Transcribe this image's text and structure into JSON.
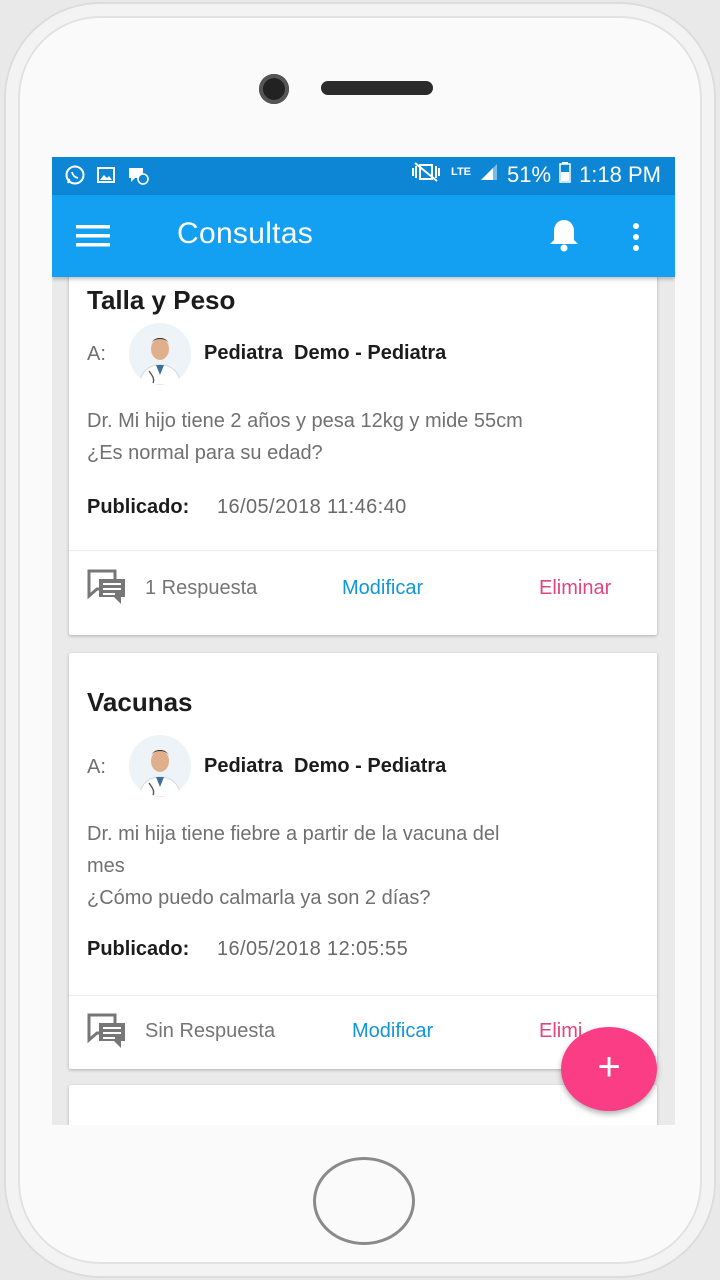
{
  "statusbar": {
    "battery": "51%",
    "time": "1:18 PM",
    "network": "LTE",
    "left_icons": [
      "whatsapp-icon",
      "image-icon",
      "message-icon"
    ],
    "right_icons": [
      "mute-vibrate-icon",
      "lte-icon",
      "signal-icon",
      "battery-icon"
    ]
  },
  "appbar": {
    "title": "Consultas",
    "icons": [
      "menu-icon",
      "bell-icon",
      "more-vert-icon"
    ]
  },
  "consultations": [
    {
      "title": "Talla y Peso",
      "to_label": "A:",
      "doctor": "Pediatra  Demo - Pediatra",
      "body_line1": "Dr. Mi hijo tiene 2 años y pesa 12kg y mide 55cm",
      "body_line2": "¿Es normal para su edad?",
      "published_label": "Publicado:",
      "published_value": "16/05/2018 11:46:40",
      "responses": "1 Respuesta",
      "modify": "Modificar",
      "delete": "Eliminar"
    },
    {
      "title": "Vacunas",
      "to_label": "A:",
      "doctor": "Pediatra  Demo - Pediatra",
      "body_line1": "Dr. mi hija tiene fiebre a partir de la vacuna del",
      "body_line2": "mes",
      "body_line3": "¿Cómo  puedo calmarla ya son 2 días?",
      "published_label": "Publicado:",
      "published_value": "16/05/2018 12:05:55",
      "responses": "Sin Respuesta",
      "modify": "Modificar",
      "delete": "Elimi"
    }
  ],
  "fab": {
    "label": "+"
  },
  "colors": {
    "statusbar": "#0d86d6",
    "appbar": "#14a0f2",
    "modify": "#1196d8",
    "delete": "#e0457e",
    "fab": "#fb3d86"
  }
}
